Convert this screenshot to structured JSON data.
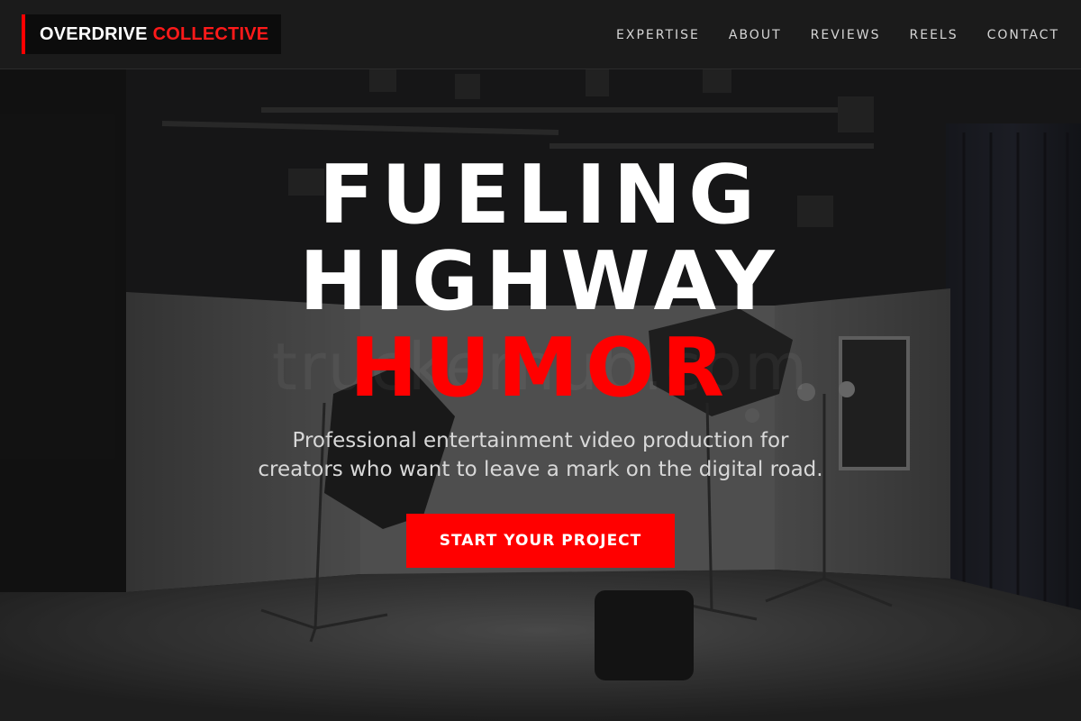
{
  "header": {
    "logo_white": "OVERDRIVE",
    "logo_red": "COLLECTIVE",
    "nav": [
      "EXPERTISE",
      "ABOUT",
      "REVIEWS",
      "REELS",
      "CONTACT"
    ]
  },
  "hero": {
    "headline_line1": "FUELING",
    "headline_line2": "HIGHWAY",
    "headline_line3": "HUMOR",
    "tagline_line1": "Professional entertainment video production for",
    "tagline_line2": "creators who want to leave a mark on the digital road.",
    "cta_label": "START YOUR PROJECT",
    "watermark": "truckerhub.com",
    "background_image": "photo studio with lights and softboxes"
  },
  "colors": {
    "accent": "#ff0000",
    "header_bg": "#1b1b1b",
    "text": "#ffffff"
  }
}
